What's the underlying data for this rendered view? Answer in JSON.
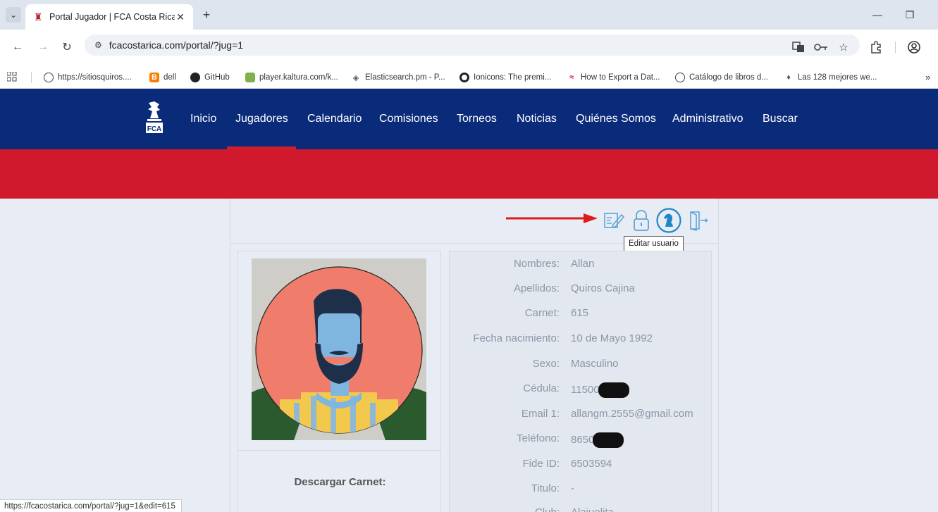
{
  "browser": {
    "tab_title": "Portal Jugador | FCA Costa Rica",
    "tab_close": "✕",
    "new_tab": "+",
    "url": "fcacostarica.com/portal/?jug=1",
    "bookmarks": [
      {
        "label": "https://sitiosquiros....",
        "icon": "globe-icon"
      },
      {
        "label": "dell",
        "icon": "blogger-icon"
      },
      {
        "label": "GitHub",
        "icon": "github-icon"
      },
      {
        "label": "player.kaltura.com/k...",
        "icon": "kaltura-icon"
      },
      {
        "label": "Elasticsearch.pm - P...",
        "icon": "elasticsearch-icon"
      },
      {
        "label": "Ionicons: The premi...",
        "icon": "ionicons-icon"
      },
      {
        "label": "How to Export a Dat...",
        "icon": "export-icon"
      },
      {
        "label": "Catálogo de libros d...",
        "icon": "globe-icon"
      },
      {
        "label": "Las 128 mejores we...",
        "icon": "pinterest-icon"
      }
    ],
    "status_url": "https://fcacostarica.com/portal/?jug=1&edit=615"
  },
  "site": {
    "logo_text": "FCA",
    "nav": [
      {
        "label": "Inicio"
      },
      {
        "label": "Jugadores"
      },
      {
        "label": "Calendario"
      },
      {
        "label": "Comisiones"
      },
      {
        "label": "Torneos"
      },
      {
        "label": "Noticias"
      },
      {
        "label": "Quiénes Somos"
      },
      {
        "label": "Administrativo"
      },
      {
        "label": "Buscar"
      }
    ],
    "active_nav": "Jugadores",
    "colors": {
      "nav_bg": "#0a2a7a",
      "accent_red": "#d0192c",
      "icon_blue": "#1f86c7"
    }
  },
  "profile": {
    "tooltip": "Editar usuario",
    "actions": [
      "edit-user-icon",
      "lock-icon",
      "knight-icon",
      "logout-icon"
    ],
    "download_label": "Descargar Carnet:",
    "fields": [
      {
        "label": "Nombres:",
        "value": "Allan"
      },
      {
        "label": "Apellidos:",
        "value": "Quiros Cajina"
      },
      {
        "label": "Carnet:",
        "value": "615"
      },
      {
        "label": "Fecha nacimiento:",
        "value": "10 de Mayo 1992"
      },
      {
        "label": "Sexo:",
        "value": "Masculino"
      },
      {
        "label": "Cédula:",
        "value": "11500",
        "redacted": true
      },
      {
        "label": "Email 1:",
        "value": "allangm.2555@gmail.com"
      },
      {
        "label": "Teléfono:",
        "value": "8650",
        "redacted": true
      },
      {
        "label": "Fide ID:",
        "value": "6503594"
      },
      {
        "label": "Titulo:",
        "value": "-"
      },
      {
        "label": "Club:",
        "value": "Alajuelita"
      }
    ]
  }
}
